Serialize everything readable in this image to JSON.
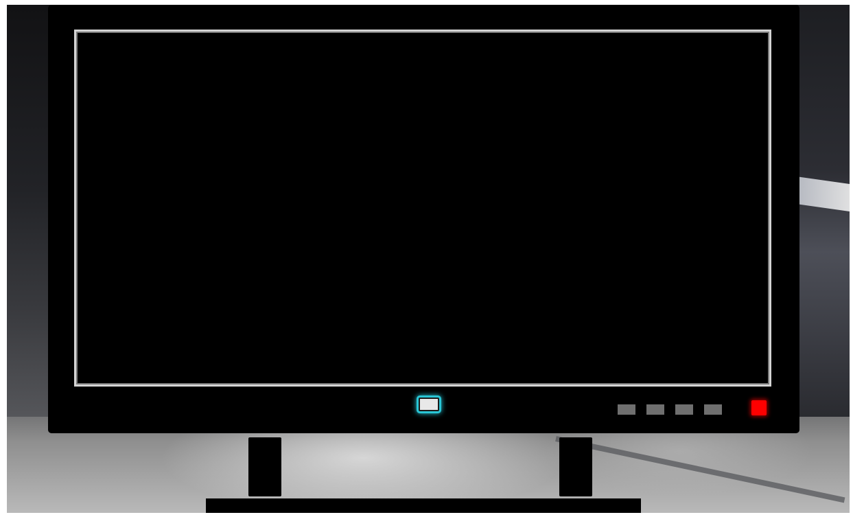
{
  "scene": {
    "background": "garage-interior-photo",
    "accent_colors": {
      "power_led": "#29c6d6",
      "red_button": "#ff0000",
      "screen_border": "#d4d4d4",
      "control_buttons": "#6f6f6f"
    }
  },
  "monitor": {
    "screen_state": "off",
    "control_buttons": [
      {
        "icon": "menu-button"
      },
      {
        "icon": "up-button"
      },
      {
        "icon": "down-button"
      },
      {
        "icon": "source-button"
      }
    ],
    "power_button_icon": "power-button"
  }
}
